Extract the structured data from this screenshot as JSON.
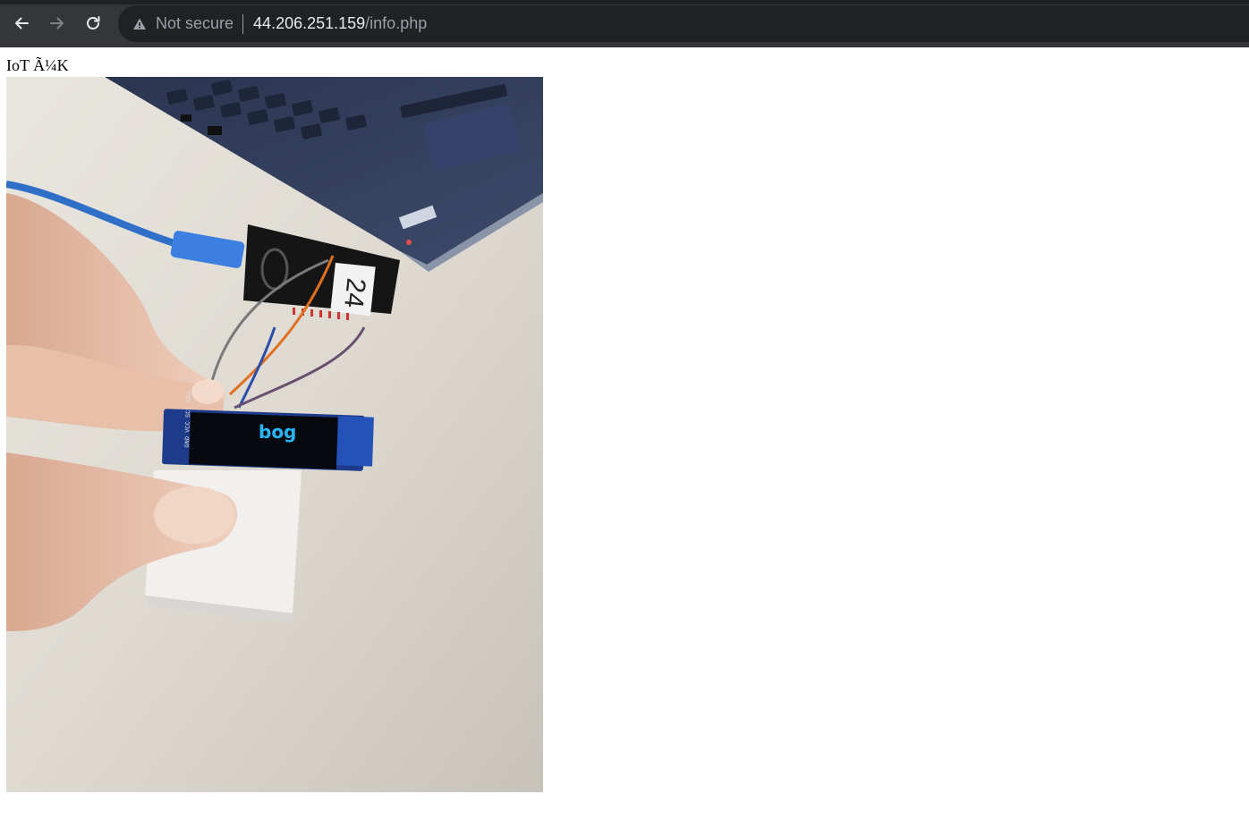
{
  "browser": {
    "security_label": "Not secure",
    "url_host": "44.206.251.159",
    "url_path": "/info.php",
    "icons": [
      "back-arrow-icon",
      "forward-arrow-icon",
      "reload-icon",
      "warning-triangle-icon"
    ]
  },
  "page": {
    "heading": "IoT Ã¼K",
    "image": {
      "display_text": "bog",
      "board_label": "24",
      "colors": {
        "oled_text": "#29b6f6",
        "cable": "#2a6fd0"
      }
    }
  }
}
